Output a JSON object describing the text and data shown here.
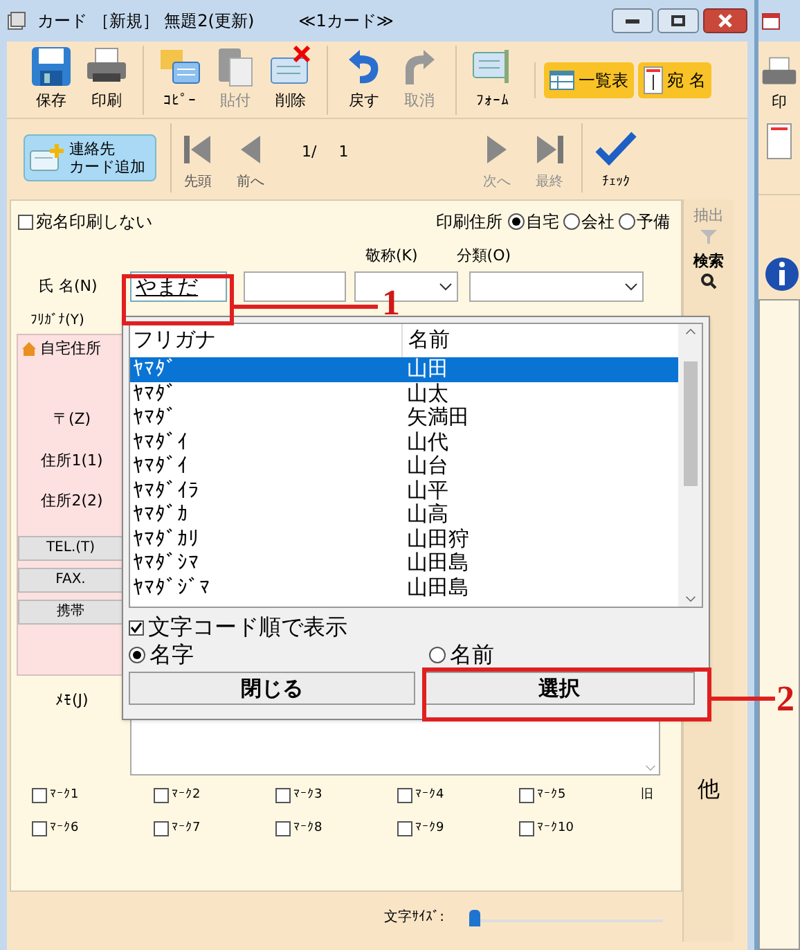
{
  "window": {
    "title": "カード ［新規］ 無題2(更新)",
    "subtitle": "≪1カード≫"
  },
  "toolbar": [
    {
      "label": "保存",
      "disabled": false
    },
    {
      "label": "印刷",
      "disabled": false
    },
    {
      "label": "ｺﾋﾟｰ",
      "disabled": false
    },
    {
      "label": "貼付",
      "disabled": true
    },
    {
      "label": "削除",
      "disabled": false
    },
    {
      "label": "戻す",
      "disabled": false
    },
    {
      "label": "取消",
      "disabled": true
    },
    {
      "label": "ﾌｫｰﾑ",
      "disabled": false
    }
  ],
  "view_buttons": [
    {
      "label": "一覧表"
    },
    {
      "label": "宛 名"
    }
  ],
  "add_button": {
    "lines": [
      "連絡先",
      "カード追加"
    ]
  },
  "nav": [
    {
      "label": "先頭",
      "disabled": false
    },
    {
      "label": "前へ",
      "disabled": false
    },
    {
      "label": "次へ",
      "disabled": true
    },
    {
      "label": "最終",
      "disabled": true
    }
  ],
  "page": {
    "current": "1/",
    "total": "1"
  },
  "check_button": {
    "label": "ﾁｪｯｸ"
  },
  "form": {
    "no_print": {
      "label": "宛名印刷しない",
      "checked": false
    },
    "print_address": {
      "label": "印刷住所",
      "options": [
        {
          "label": "自宅",
          "selected": true
        },
        {
          "label": "会社",
          "selected": false
        },
        {
          "label": "予備",
          "selected": false
        }
      ]
    },
    "honorific_label": "敬称(K)",
    "category_label": "分類(O)",
    "name_label": "氏 名(N)",
    "name_value": "やまだ",
    "furigana_label": "ﾌﾘｶﾞﾅ(Y)",
    "address_tab": "自宅住所",
    "address_labels": [
      "〒(Z)",
      "住所1(1)",
      "住所2(2)"
    ],
    "phone_buttons": [
      "TEL.(T)",
      "FAX.",
      "携帯"
    ],
    "memo_label": "ﾒﾓ(J)",
    "marks": [
      {
        "label": "ﾏｰｸ1",
        "checked": false
      },
      {
        "label": "ﾏｰｸ2",
        "checked": false
      },
      {
        "label": "ﾏｰｸ3",
        "checked": false
      },
      {
        "label": "ﾏｰｸ4",
        "checked": false
      },
      {
        "label": "ﾏｰｸ5",
        "checked": false
      },
      {
        "label": "ﾏｰｸ6",
        "checked": false
      },
      {
        "label": "ﾏｰｸ7",
        "checked": false
      },
      {
        "label": "ﾏｰｸ8",
        "checked": false
      },
      {
        "label": "ﾏｰｸ9",
        "checked": false
      },
      {
        "label": "ﾏｰｸ10",
        "checked": false
      }
    ],
    "old_label": "旧",
    "font_size": {
      "label": "文字ｻｲｽﾞ:",
      "level": 0
    }
  },
  "sidebar": {
    "buttons": [
      {
        "label": "抽出",
        "disabled": true
      },
      {
        "label": "検索",
        "disabled": false
      }
    ],
    "index": [
      "他"
    ]
  },
  "popup": {
    "columns": [
      "フリガナ",
      "名前"
    ],
    "rows": [
      {
        "furigana": "ﾔﾏﾀﾞ",
        "name": "山田",
        "selected": true
      },
      {
        "furigana": "ﾔﾏﾀﾞ",
        "name": "山太",
        "selected": false
      },
      {
        "furigana": "ﾔﾏﾀﾞ",
        "name": "矢満田",
        "selected": false
      },
      {
        "furigana": "ﾔﾏﾀﾞｲ",
        "name": "山代",
        "selected": false
      },
      {
        "furigana": "ﾔﾏﾀﾞｲ",
        "name": "山台",
        "selected": false
      },
      {
        "furigana": "ﾔﾏﾀﾞｲﾗ",
        "name": "山平",
        "selected": false
      },
      {
        "furigana": "ﾔﾏﾀﾞｶ",
        "name": "山高",
        "selected": false
      },
      {
        "furigana": "ﾔﾏﾀﾞｶﾘ",
        "name": "山田狩",
        "selected": false
      },
      {
        "furigana": "ﾔﾏﾀﾞｼﾏ",
        "name": "山田島",
        "selected": false
      },
      {
        "furigana": "ﾔﾏﾀﾞｼﾞﾏ",
        "name": "山田島",
        "selected": false
      }
    ],
    "sort_checkbox": {
      "label": "文字コード順で表示",
      "checked": true
    },
    "modes": [
      {
        "label": "名字",
        "selected": true
      },
      {
        "label": "名前",
        "selected": false
      }
    ],
    "buttons": [
      "閉じる",
      "選択"
    ]
  },
  "annotations": [
    {
      "label": "1"
    },
    {
      "label": "2"
    }
  ],
  "second_window": {
    "toolbar_label": "印"
  }
}
